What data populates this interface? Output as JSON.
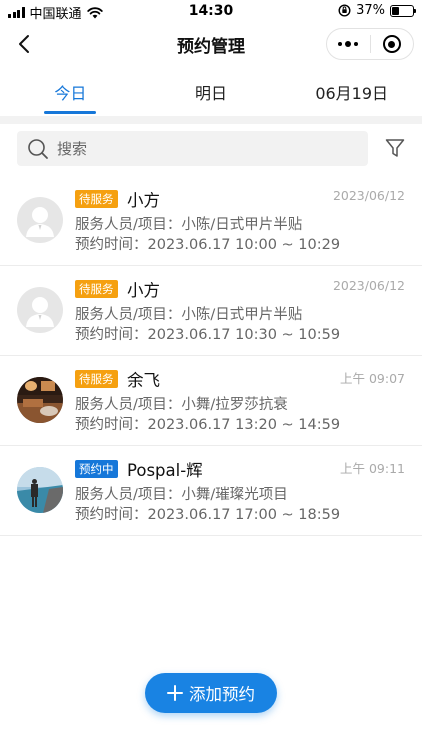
{
  "status_bar": {
    "carrier": "中国联通",
    "time": "14:30",
    "battery": "37%",
    "battery_level": 0.37
  },
  "nav": {
    "title": "预约管理"
  },
  "tabs": [
    {
      "label": "今日",
      "active": true
    },
    {
      "label": "明日",
      "active": false
    },
    {
      "label": "06月19日",
      "active": false
    }
  ],
  "search": {
    "placeholder": "搜索"
  },
  "appointments": [
    {
      "status": "待服务",
      "status_type": "wait",
      "name": "小方",
      "time": "2023/06/12",
      "staff_item_label": "服务人员/项目：",
      "staff_item": "小陈/日式甲片半贴",
      "appt_time_label": "预约时间：",
      "appt_time": "2023.06.17 10:00 ~ 10:29",
      "avatar": "default-avatar"
    },
    {
      "status": "待服务",
      "status_type": "wait",
      "name": "小方",
      "time": "2023/06/12",
      "staff_item_label": "服务人员/项目：",
      "staff_item": "小陈/日式甲片半贴",
      "appt_time_label": "预约时间：",
      "appt_time": "2023.06.17 10:30 ~ 10:59",
      "avatar": "default-avatar"
    },
    {
      "status": "待服务",
      "status_type": "wait",
      "name": "余飞",
      "time": "上午 09:07",
      "staff_item_label": "服务人员/项目：",
      "staff_item": "小舞/拉罗莎抗衰",
      "appt_time_label": "预约时间：",
      "appt_time": "2023.06.17 13:20 ~ 14:59",
      "avatar": "photo-avatar-room"
    },
    {
      "status": "预约中",
      "status_type": "booked",
      "name": "Pospal-辉",
      "time": "上午 09:11",
      "staff_item_label": "服务人员/项目：",
      "staff_item": "小舞/璀璨光项目",
      "appt_time_label": "预约时间：",
      "appt_time": "2023.06.17 17:00 ~ 18:59",
      "avatar": "photo-avatar-beach"
    }
  ],
  "add_button": {
    "label": "添加预约"
  },
  "colors": {
    "accent": "#1677d9",
    "wait_badge": "#f5a010",
    "booked_badge": "#1677d9"
  }
}
